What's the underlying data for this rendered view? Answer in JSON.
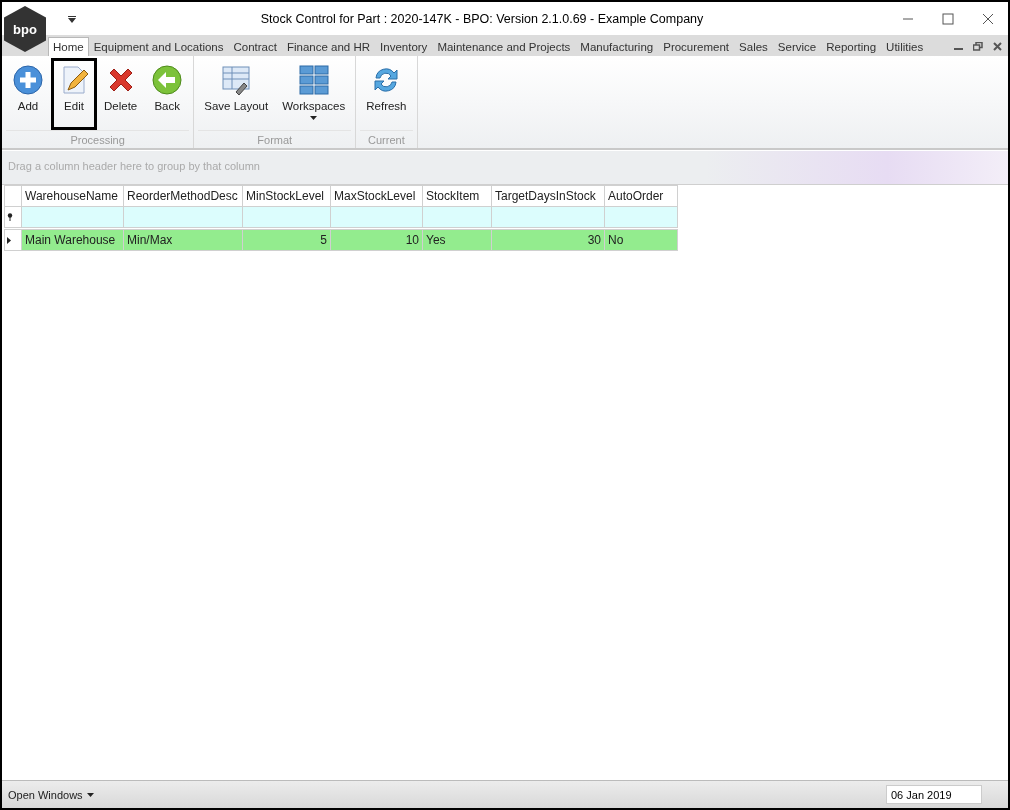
{
  "window": {
    "title": "Stock Control for Part : 2020-147K - BPO: Version 2.1.0.69 - Example Company",
    "logo": "bpo"
  },
  "tabs": [
    {
      "label": "Home",
      "selected": true
    },
    {
      "label": "Equipment and Locations",
      "selected": false
    },
    {
      "label": "Contract",
      "selected": false
    },
    {
      "label": "Finance and HR",
      "selected": false
    },
    {
      "label": "Inventory",
      "selected": false
    },
    {
      "label": "Maintenance and Projects",
      "selected": false
    },
    {
      "label": "Manufacturing",
      "selected": false
    },
    {
      "label": "Procurement",
      "selected": false
    },
    {
      "label": "Sales",
      "selected": false
    },
    {
      "label": "Service",
      "selected": false
    },
    {
      "label": "Reporting",
      "selected": false
    },
    {
      "label": "Utilities",
      "selected": false
    }
  ],
  "ribbon_groups": [
    {
      "label": "Processing",
      "buttons": [
        {
          "label": "Add",
          "kind": "add",
          "highlighted": false
        },
        {
          "label": "Edit",
          "kind": "edit",
          "highlighted": true
        },
        {
          "label": "Delete",
          "kind": "delete",
          "highlighted": false
        },
        {
          "label": "Back",
          "kind": "back",
          "highlighted": false
        }
      ]
    },
    {
      "label": "Format",
      "buttons": [
        {
          "label": "Save Layout",
          "kind": "layout",
          "highlighted": false
        },
        {
          "label": "Workspaces",
          "kind": "workspaces",
          "highlighted": false
        }
      ]
    },
    {
      "label": "Current",
      "buttons": [
        {
          "label": "Refresh",
          "kind": "refresh",
          "highlighted": false
        }
      ]
    }
  ],
  "group_panel": {
    "placeholder": "Drag a column header here to group by that column"
  },
  "table": {
    "columns": [
      {
        "label": "WarehouseName",
        "kind": "text"
      },
      {
        "label": "ReorderMethodDesc",
        "kind": "text"
      },
      {
        "label": "MinStockLevel",
        "kind": "number"
      },
      {
        "label": "MaxStockLevel",
        "kind": "number"
      },
      {
        "label": "StockItem",
        "kind": "text"
      },
      {
        "label": "TargetDaysInStock",
        "kind": "number"
      },
      {
        "label": "AutoOrder",
        "kind": "text"
      }
    ],
    "rows": [
      {
        "selected": true,
        "cells": [
          "Main Warehouse",
          "Min/Max",
          "5",
          "10",
          "Yes",
          "30",
          "No"
        ]
      }
    ]
  },
  "status_bar": {
    "menu": "Open Windows",
    "date": "06 Jan 2019"
  }
}
